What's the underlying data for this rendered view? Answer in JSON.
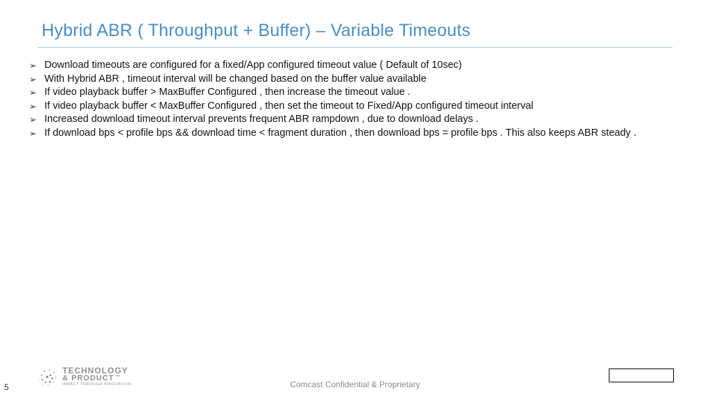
{
  "title": "Hybrid ABR ( Throughput + Buffer) – Variable Timeouts",
  "bullets": [
    "Download timeouts are configured for a fixed/App configured timeout value ( Default of 10sec)",
    "With Hybrid ABR , timeout interval will be changed based on the buffer value available",
    "If video playback buffer > MaxBuffer Configured   , then increase the timeout value .",
    "If video playback buffer < MaxBuffer Configured , then set the timeout to Fixed/App configured timeout interval",
    "Increased download timeout interval prevents frequent ABR rampdown  , due to download delays .",
    "If download bps < profile bps && download time < fragment duration , then download bps = profile bps . This also keeps ABR steady ."
  ],
  "footer": {
    "page_number": "5",
    "confidential": "Comcast Confidential & Proprietary",
    "logo_line1": "TECHNOLOGY",
    "logo_line2": "& PRODUCT",
    "logo_tm": "™",
    "logo_tag": "IMPACT THROUGH INNOVATION"
  }
}
